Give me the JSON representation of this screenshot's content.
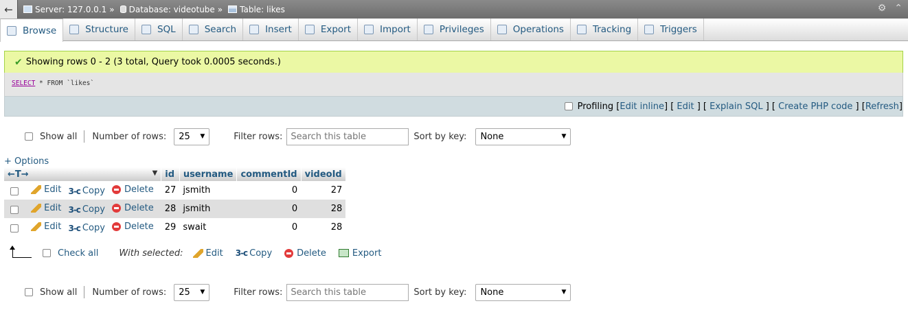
{
  "breadcrumb": {
    "back": "←",
    "server": "Server: 127.0.0.1",
    "database": "Database: videotube",
    "table": "Table: likes",
    "separator": "»"
  },
  "tabs": [
    {
      "label": "Browse",
      "icon": "browse-icon"
    },
    {
      "label": "Structure",
      "icon": "structure-icon"
    },
    {
      "label": "SQL",
      "icon": "sql-icon"
    },
    {
      "label": "Search",
      "icon": "search-icon"
    },
    {
      "label": "Insert",
      "icon": "insert-icon"
    },
    {
      "label": "Export",
      "icon": "export-icon"
    },
    {
      "label": "Import",
      "icon": "import-icon"
    },
    {
      "label": "Privileges",
      "icon": "privileges-icon"
    },
    {
      "label": "Operations",
      "icon": "operations-icon"
    },
    {
      "label": "Tracking",
      "icon": "tracking-icon"
    },
    {
      "label": "Triggers",
      "icon": "triggers-icon"
    }
  ],
  "message": {
    "text": "Showing rows 0 - 2 (3 total, Query took 0.0005 seconds.)"
  },
  "sql": {
    "keyword": "SELECT",
    "rest": " * FROM `likes`"
  },
  "sql_tools": {
    "profiling": "Profiling",
    "edit_inline": "Edit inline",
    "edit": "Edit",
    "explain": "Explain SQL",
    "php": "Create PHP code",
    "refresh": "Refresh"
  },
  "nav": {
    "show_all": "Show all",
    "num_rows_label": "Number of rows:",
    "num_rows_value": "25",
    "filter_label": "Filter rows:",
    "filter_placeholder": "Search this table",
    "sort_label": "Sort by key:",
    "sort_value": "None"
  },
  "options_label": "+ Options",
  "table": {
    "arrows": "←T→",
    "columns": [
      "id",
      "username",
      "commentId",
      "videoId"
    ],
    "actions": {
      "edit": "Edit",
      "copy": "Copy",
      "delete": "Delete"
    },
    "rows": [
      {
        "id": "27",
        "username": "jsmith",
        "commentId": "0",
        "videoId": "27"
      },
      {
        "id": "28",
        "username": "jsmith",
        "commentId": "0",
        "videoId": "28"
      },
      {
        "id": "29",
        "username": "swait",
        "commentId": "0",
        "videoId": "28"
      }
    ]
  },
  "bulk": {
    "check_all": "Check all",
    "with_selected": "With selected:",
    "edit": "Edit",
    "copy": "Copy",
    "delete": "Delete",
    "export": "Export"
  }
}
